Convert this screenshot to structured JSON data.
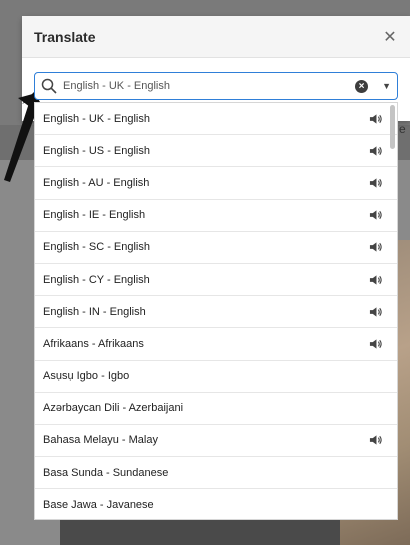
{
  "dialog": {
    "title": "Translate"
  },
  "search": {
    "value": "English - UK - English"
  },
  "languages": [
    {
      "label": "English - UK - English",
      "audio": true
    },
    {
      "label": "English - US - English",
      "audio": true
    },
    {
      "label": "English - AU - English",
      "audio": true
    },
    {
      "label": "English - IE - English",
      "audio": true
    },
    {
      "label": "English - SC - English",
      "audio": true
    },
    {
      "label": "English - CY - English",
      "audio": true
    },
    {
      "label": "English - IN - English",
      "audio": true
    },
    {
      "label": "Afrikaans - Afrikaans",
      "audio": true
    },
    {
      "label": "Asụsụ Igbo - Igbo",
      "audio": false
    },
    {
      "label": "Azərbaycan Dili - Azerbaijani",
      "audio": false
    },
    {
      "label": "Bahasa Melayu - Malay",
      "audio": true
    },
    {
      "label": "Basa Sunda - Sundanese",
      "audio": false
    },
    {
      "label": "Base Jawa - Javanese",
      "audio": false
    }
  ],
  "background": {
    "letter": "e"
  },
  "colors": {
    "accent": "#2f7fd8"
  }
}
